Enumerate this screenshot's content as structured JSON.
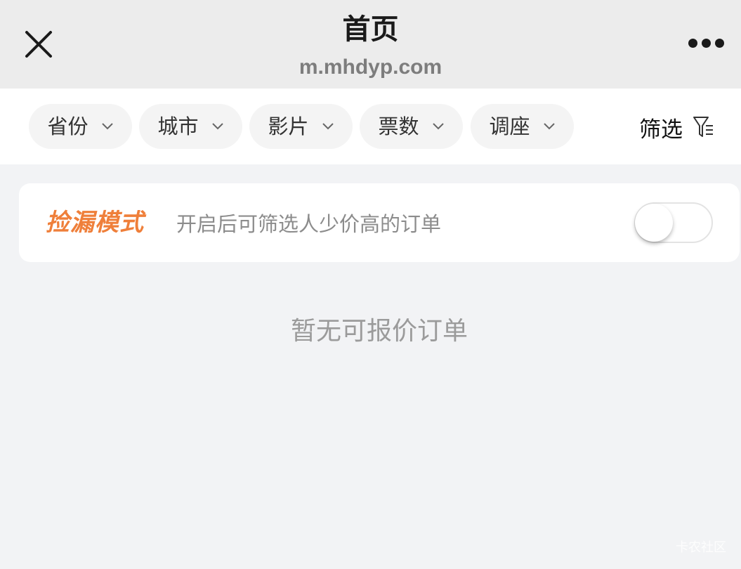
{
  "navbar": {
    "title": "首页",
    "url": "m.mhdyp.com",
    "close_icon": "close-icon",
    "more_icon": "more-dots-icon"
  },
  "filters": {
    "chips": [
      {
        "label": "省份",
        "icon": "chevron-down-icon"
      },
      {
        "label": "城市",
        "icon": "chevron-down-icon"
      },
      {
        "label": "影片",
        "icon": "chevron-down-icon"
      },
      {
        "label": "票数",
        "icon": "chevron-down-icon"
      },
      {
        "label": "调座",
        "icon": "chevron-down-icon"
      }
    ],
    "screen_label": "筛选",
    "screen_icon": "funnel-icon"
  },
  "leak_mode": {
    "logo": "捡漏模式",
    "description": "开启后可筛选人少价高的订单",
    "toggle_on": false,
    "accent_color": "#ef7f3a"
  },
  "empty_state": {
    "message": "暂无可报价订单"
  },
  "watermark": "卡农社区"
}
